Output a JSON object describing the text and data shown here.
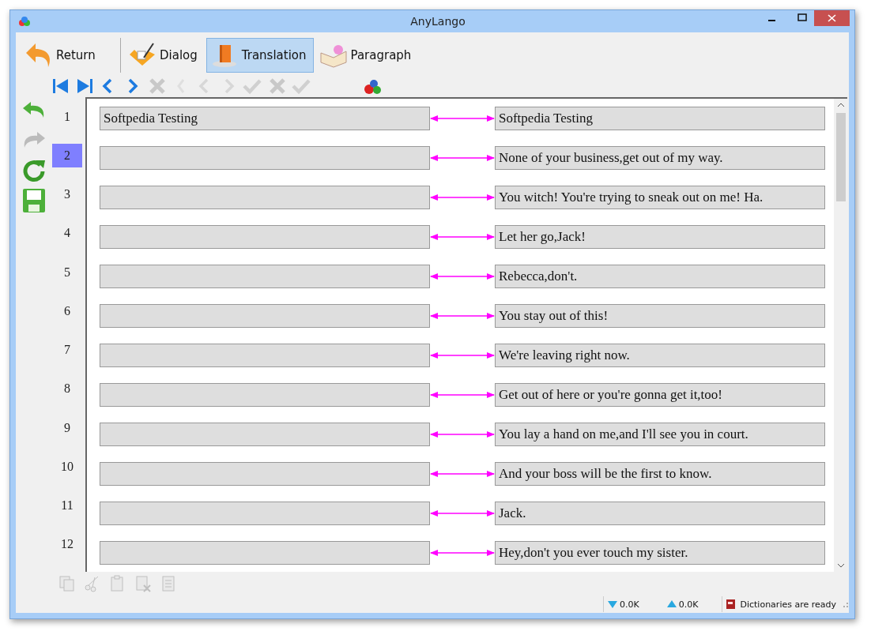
{
  "window": {
    "title": "AnyLango"
  },
  "tabs": [
    {
      "label": "Return",
      "kind": "return",
      "selected": false
    },
    {
      "label": "Dialog",
      "kind": "dialog",
      "selected": false
    },
    {
      "label": "Translation",
      "kind": "translation",
      "selected": true
    },
    {
      "label": "Paragraph",
      "kind": "paragraph",
      "selected": false
    }
  ],
  "nav_toolbar": [
    {
      "kind": "first",
      "disabled": false
    },
    {
      "kind": "last",
      "disabled": false
    },
    {
      "kind": "prev",
      "disabled": false
    },
    {
      "kind": "next",
      "disabled": false
    },
    {
      "kind": "delete",
      "disabled": true
    },
    {
      "kind": "back",
      "disabled": true
    },
    {
      "kind": "prev",
      "disabled": true
    },
    {
      "kind": "next",
      "disabled": true
    },
    {
      "kind": "check",
      "disabled": true
    },
    {
      "kind": "delete",
      "disabled": true
    },
    {
      "kind": "check",
      "disabled": true
    },
    {
      "kind": "spell",
      "disabled": false
    }
  ],
  "side_toolbar": [
    {
      "kind": "undo",
      "disabled": false
    },
    {
      "kind": "redo",
      "disabled": true
    },
    {
      "kind": "refresh",
      "disabled": false
    },
    {
      "kind": "save",
      "disabled": false
    }
  ],
  "rows": [
    {
      "number": "1",
      "selected": false,
      "source": "Softpedia Testing",
      "target": "Softpedia Testing"
    },
    {
      "number": "2",
      "selected": true,
      "target": "None of your business,get out of my way."
    },
    {
      "number": "3",
      "selected": false,
      "target": "You witch! You're trying to sneak out on me! Ha."
    },
    {
      "number": "4",
      "selected": false,
      "target": "Let her go,Jack!"
    },
    {
      "number": "5",
      "selected": false,
      "target": "Rebecca,don't."
    },
    {
      "number": "6",
      "selected": false,
      "target": "You stay out of this!"
    },
    {
      "number": "7",
      "selected": false,
      "target": "We're leaving right now."
    },
    {
      "number": "8",
      "selected": false,
      "target": "Get out of here or you're gonna get it,too!"
    },
    {
      "number": "9",
      "selected": false,
      "target": "You lay a hand on me,and I'll see you in court."
    },
    {
      "number": "10",
      "selected": false,
      "target": "And your boss will be the first to know."
    },
    {
      "number": "11",
      "selected": false,
      "target": "Jack."
    },
    {
      "number": "12",
      "selected": false,
      "target": "Hey,don't you ever touch my sister."
    }
  ],
  "edit_toolbar": [
    {
      "kind": "copy",
      "disabled": true
    },
    {
      "kind": "cut",
      "disabled": true
    },
    {
      "kind": "paste",
      "disabled": true
    },
    {
      "kind": "clear",
      "disabled": true
    },
    {
      "kind": "document",
      "disabled": true
    }
  ],
  "status_bar": {
    "download": "0.0K",
    "upload": "0.0K",
    "message": "Dictionaries are ready"
  }
}
